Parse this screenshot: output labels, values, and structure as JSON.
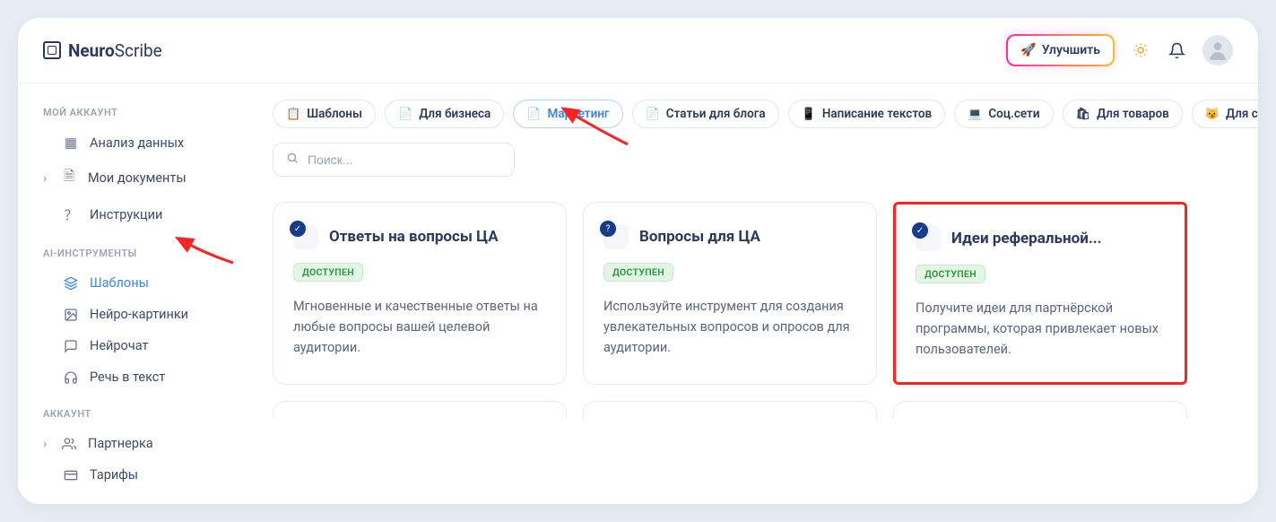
{
  "app": {
    "name_bold": "Neuro",
    "name_thin": "Scribe"
  },
  "header": {
    "upgrade_label": "Улучшить"
  },
  "sidebar": {
    "section_account": "МОЙ АККАУНТ",
    "section_tools": "AI-ИНСТРУМЕНТЫ",
    "section_user": "АККАУНТ",
    "items_account": [
      {
        "icon": "grid-icon",
        "label": "Анализ данных"
      },
      {
        "icon": "doc-icon",
        "label": "Мои документы",
        "caret": true
      },
      {
        "icon": "help-icon",
        "label": "Инструкции"
      }
    ],
    "items_tools": [
      {
        "icon": "layers-icon",
        "label": "Шаблоны",
        "active": true
      },
      {
        "icon": "image-icon",
        "label": "Нейро-картинки"
      },
      {
        "icon": "chat-icon",
        "label": "Нейрочат"
      },
      {
        "icon": "headphones-icon",
        "label": "Речь в текст"
      }
    ],
    "items_user": [
      {
        "icon": "users-icon",
        "label": "Партнерка",
        "caret": true
      },
      {
        "icon": "card-icon",
        "label": "Тарифы"
      }
    ]
  },
  "search": {
    "placeholder": "Поиск..."
  },
  "categories": [
    {
      "icon": "📋",
      "label": "Шаблоны"
    },
    {
      "icon": "📄",
      "label": "Для бизнеса"
    },
    {
      "icon": "📄",
      "label": "Маркетинг",
      "active": true
    },
    {
      "icon": "📄",
      "label": "Статьи для блога"
    },
    {
      "icon": "📱",
      "label": "Написание текстов"
    },
    {
      "icon": "💻",
      "label": "Соц.сети"
    },
    {
      "icon": "🛍",
      "label": "Для товаров"
    },
    {
      "icon": "😼",
      "label": "Для сайта"
    }
  ],
  "cards": [
    {
      "title": "Ответы на вопросы ЦА",
      "status": "ДОСТУПЕН",
      "desc": "Мгновенные и качественные ответы на любые вопросы вашей целевой аудитории.",
      "badge": "check"
    },
    {
      "title": "Вопросы для ЦА",
      "status": "ДОСТУПЕН",
      "desc": "Используйте инструмент для создания увлекательных вопросов и опросов для аудитории.",
      "badge": "question"
    },
    {
      "title": "Идеи реферальной...",
      "status": "ДОСТУПЕН",
      "desc": "Получите идеи для партнёрской программы, которая привлекает новых пользователей.",
      "badge": "check",
      "highlight": true
    }
  ]
}
